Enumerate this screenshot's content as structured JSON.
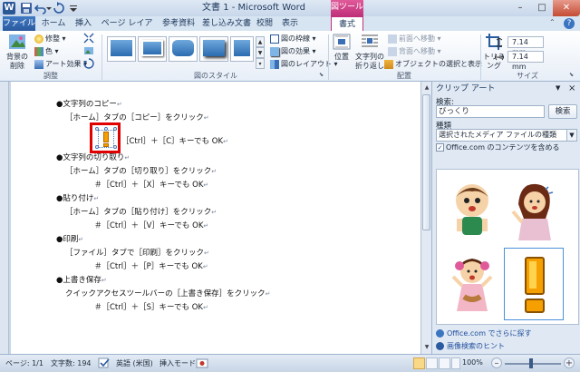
{
  "window": {
    "title": "文書 1 - Microsoft Word",
    "contextual_header": "図ツール",
    "min": "–",
    "max": "□",
    "close": "✕"
  },
  "tabs": [
    "ファイル",
    "ホーム",
    "挿入",
    "ページ レイアウト",
    "参考資料",
    "差し込み文書",
    "校閲",
    "表示",
    "書式"
  ],
  "ribbon": {
    "adjust": {
      "remove_bg": "背景の\n削除",
      "corrections": "修整",
      "color": "色",
      "artistic": "アート効果",
      "label": "調整"
    },
    "styles": {
      "label": "図のスタイル",
      "border": "図の枠線",
      "effects": "図の効果",
      "layout": "図のレイアウト"
    },
    "arrange": {
      "position": "位置",
      "wrap": "文字列の\n折り返し",
      "bring_forward": "前面へ移動",
      "send_backward": "背面へ移動",
      "selection_pane": "オブジェクトの選択と表示",
      "label": "配置"
    },
    "size": {
      "crop": "トリミング",
      "height": "7.14 mm",
      "width": "7.14 mm",
      "label": "サイズ"
    }
  },
  "document": {
    "lines": [
      "●文字列のコピー",
      "［ホーム］タブの［コピー］をクリック",
      "［Ctrl］＋［C］キーでも OK",
      "●文字列の切り取り",
      "［ホーム］タブの［切り取り］をクリック",
      "＃［Ctrl］＋［X］キーでも OK",
      "●貼り付け",
      "［ホーム］タブの［貼り付け］をクリック",
      "＃［Ctrl］＋［V］キーでも OK",
      "●印刷",
      "［ファイル］タブで［印刷］をクリック",
      "＃［Ctrl］＋［P］キーでも OK",
      "●上書き保存",
      "クイックアクセスツールバーの［上書き保存］をクリック",
      "＃［Ctrl］＋［S］キーでも OK"
    ],
    "para_mark": "↵"
  },
  "clipart_pane": {
    "title": "クリップ アート",
    "search_label": "検索:",
    "search_value": "びっくり",
    "search_button": "検索",
    "type_label": "種類",
    "type_value": "選択されたメディア ファイルの種類",
    "include_label": "Office.com のコンテンツを含める",
    "include_checked": "✓",
    "link_more": "Office.com でさらに探す",
    "link_hint": "画像検索のヒント"
  },
  "status": {
    "page": "ページ: 1/1",
    "words": "文字数: 194",
    "language": "英語 (米国)",
    "insert_mode": "挿入モード",
    "zoom": "100%"
  },
  "colors": {
    "contextual_pink": "#c0307a",
    "file_tab_blue": "#2a5a9f",
    "selection_red": "#e00000"
  }
}
